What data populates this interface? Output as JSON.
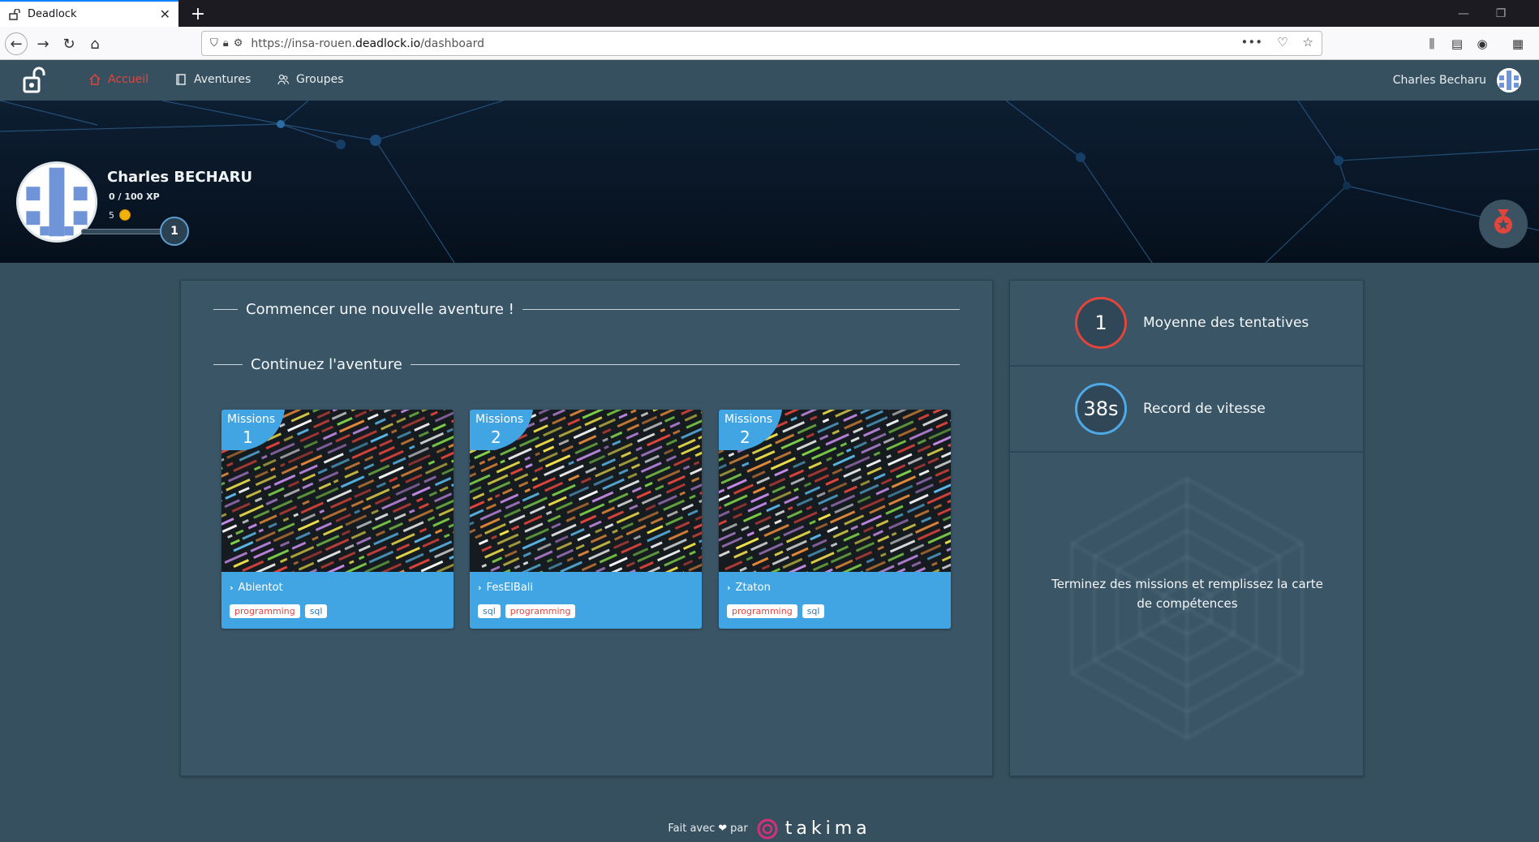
{
  "browser": {
    "tab_title": "Deadlock",
    "url_prefix": "https://insa-rouen.",
    "url_host": "deadlock.io",
    "url_path": "/dashboard",
    "new_tab_label": "+"
  },
  "app_nav": {
    "items": [
      {
        "label": "Accueil",
        "icon": "home-icon",
        "active": true
      },
      {
        "label": "Aventures",
        "icon": "book-icon",
        "active": false
      },
      {
        "label": "Groupes",
        "icon": "group-icon",
        "active": false
      }
    ],
    "user_name": "Charles Becharu"
  },
  "profile": {
    "name": "Charles BECHARU",
    "xp": "0 / 100 XP",
    "coins": "5",
    "level": "1"
  },
  "main": {
    "new_adventure_title": "Commencer une nouvelle aventure !",
    "continue_title": "Continuez l'aventure",
    "cards": [
      {
        "badge_label": "Missions",
        "missions": "1",
        "title": "Abientot",
        "tags": [
          "programming",
          "sql"
        ]
      },
      {
        "badge_label": "Missions",
        "missions": "2",
        "title": "FesElBali",
        "tags": [
          "sql",
          "programming"
        ]
      },
      {
        "badge_label": "Missions",
        "missions": "2",
        "title": "Ztaton",
        "tags": [
          "programming",
          "sql"
        ]
      }
    ]
  },
  "stats": {
    "avg_attempts_value": "1",
    "avg_attempts_label": "Moyenne des tentatives",
    "speed_record_value": "38s",
    "speed_record_label": "Record de vitesse",
    "radar_message": "Terminez des missions et remplissez la carte de compétences"
  },
  "footer": {
    "made_with": "Fait avec",
    "by": "par",
    "brand": "takima"
  },
  "colors": {
    "accent_red": "#e2453c",
    "accent_blue": "#42a5e3",
    "background": "#36505f"
  }
}
